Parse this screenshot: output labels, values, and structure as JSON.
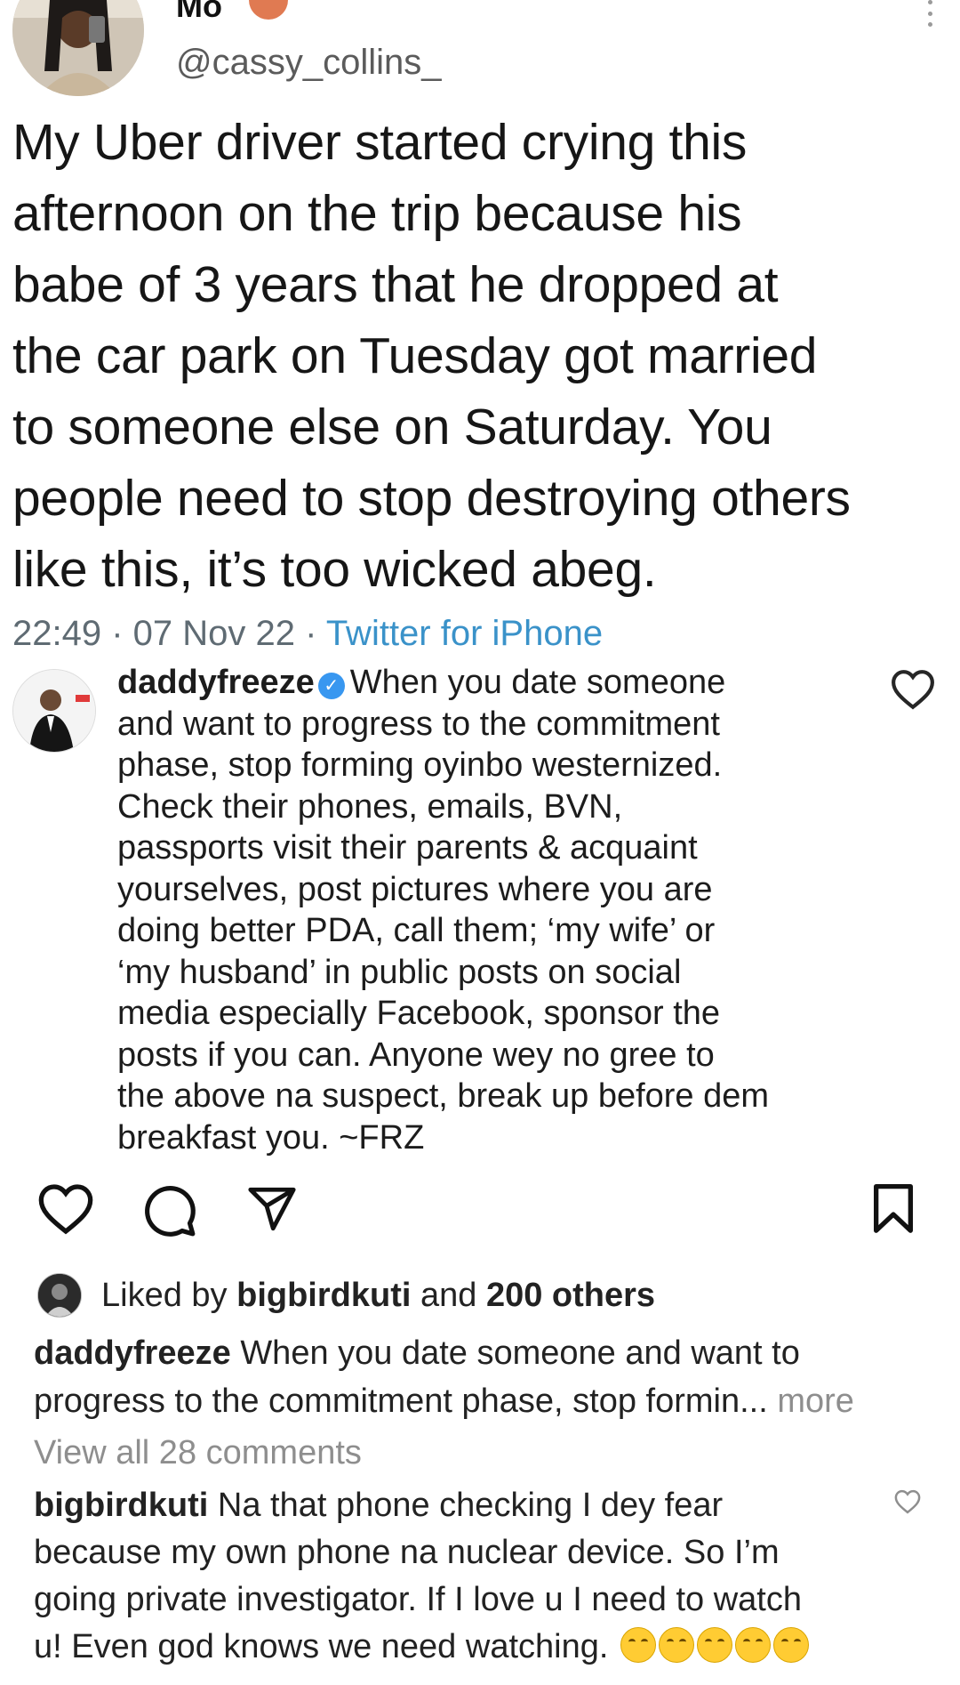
{
  "tweet": {
    "name": "Mo",
    "handle": "@cassy_collins_",
    "text_lines": [
      "My Uber driver started crying this",
      "afternoon on the trip because his",
      "babe of 3 years that he dropped at",
      "the car park on Tuesday got married",
      "to someone else on Saturday. You",
      "people need to stop destroying others",
      "like this, it’s too wicked abeg."
    ],
    "time": "22:49",
    "date": "07 Nov 22",
    "separator": " · ",
    "source": "Twitter for iPhone"
  },
  "post": {
    "username": "daddyfreeze",
    "caption_lines": [
      "When you date someone",
      "and want to progress to the commitment",
      "phase, stop forming oyinbo westernized.",
      "Check their phones, emails, BVN,",
      "passports visit their parents & acquaint",
      "yourselves, post pictures where you are",
      "doing better PDA, call them; ‘my wife’ or",
      "‘my husband’ in public posts on social",
      "media especially Facebook, sponsor the",
      "posts if you can. Anyone wey no gree to",
      "the above na suspect, break up before dem",
      "breakfast you. ~FRZ"
    ],
    "liked_by_prefix": "Liked by",
    "liked_by_user": "bigbirdkuti",
    "liked_by_and": "and",
    "liked_by_others": "200 others",
    "caption_preview_user": "daddyfreeze",
    "caption_preview_line1": "When you date someone and want to",
    "caption_preview_line2": "progress to the commitment phase, stop formin...",
    "more_label": "more",
    "view_all_comments": "View all 28 comments",
    "comment": {
      "user": "bigbirdkuti",
      "lines": [
        "Na that phone checking I dey fear",
        "because my own phone na nuclear device. So I’m",
        "going private investigator. If I love u I need to watch",
        "u! Even god knows we need watching."
      ],
      "emoji_name": "laughing-tears-emoji"
    }
  },
  "icons": {
    "verified": "verified-badge-icon",
    "like": "heart-icon",
    "comment": "comment-bubble-icon",
    "share": "paper-plane-icon",
    "save": "bookmark-icon"
  },
  "colors": {
    "tweet_source": "#3a92c9",
    "verified_blue": "#3897f0",
    "muted_gray": "#8e8e8e"
  }
}
